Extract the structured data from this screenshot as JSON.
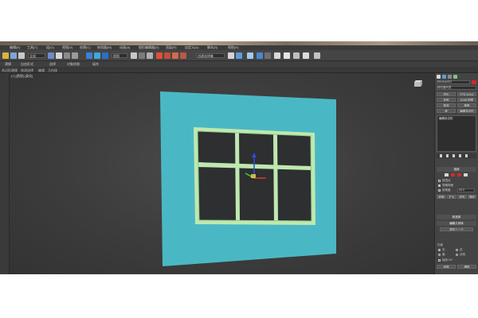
{
  "window": {
    "title": "",
    "menubar": [
      "编辑(E)",
      "工具(T)",
      "组(G)",
      "视图(V)",
      "创建(C)",
      "修改器(M)",
      "动画(A)",
      "图形编辑器(D)",
      "渲染(R)",
      "自定义(U)",
      "脚本(S)",
      "帮助(H)"
    ]
  },
  "toolbar": {
    "selection_filter": "全部",
    "view_dropdown": "视图",
    "named_selection": "创建选择集"
  },
  "ribbon": {
    "tabs": [
      "建模",
      "自由形式",
      "选择",
      "对象绘制",
      "填充"
    ]
  },
  "subribbon": {
    "items": [
      "多边形建模",
      "修改选择",
      "编辑",
      "几何体",
      "细分",
      "三角剖分"
    ]
  },
  "viewport": {
    "label": "[+] [透视] [真实]"
  },
  "command_panel": {
    "object_name": "Window001",
    "modifier_list": "修改器列表",
    "buttons": [
      "挤出",
      "FFD 2x2x2",
      "车削",
      "UVW 贴图",
      "弯曲",
      "晶格",
      "壳",
      "编辑多边形"
    ],
    "stack_items": [
      "编辑多边形"
    ],
    "section_selection": "选择",
    "checkbox_labels": [
      "按顶点",
      "忽略背面",
      "按角度"
    ],
    "angle_value": "45.0",
    "shrink_label": "收缩",
    "grow_label": "扩大",
    "ring_label": "环形",
    "loop_label": "循环",
    "soft_selection": "软选择",
    "edit_geometry": "编辑几何体",
    "repeat_last": "重复上一个",
    "constraints": "约束",
    "none_label": "无",
    "edge_label": "边",
    "face_label": "面",
    "normal_label": "法线",
    "preserve_uvs": "保持 UV",
    "create_label": "创建",
    "collapse_label": "塌陷"
  },
  "colors": {
    "wall": "#4ab8c4",
    "frame": "#bfe8b0",
    "accent_red": "#cc2b2b",
    "gizmo_blue": "#2a4fd6",
    "gizmo_green": "#3ad14a",
    "gizmo_red": "#d63a2a"
  },
  "icons": [
    "select-icon",
    "move-icon",
    "rotate-icon",
    "scale-icon",
    "snap-icon",
    "mirror-icon",
    "align-icon",
    "layer-icon",
    "render-setup-icon",
    "render-frame-icon",
    "render-icon",
    "teapot-icon",
    "viewcube-icon",
    "plus-icon"
  ]
}
